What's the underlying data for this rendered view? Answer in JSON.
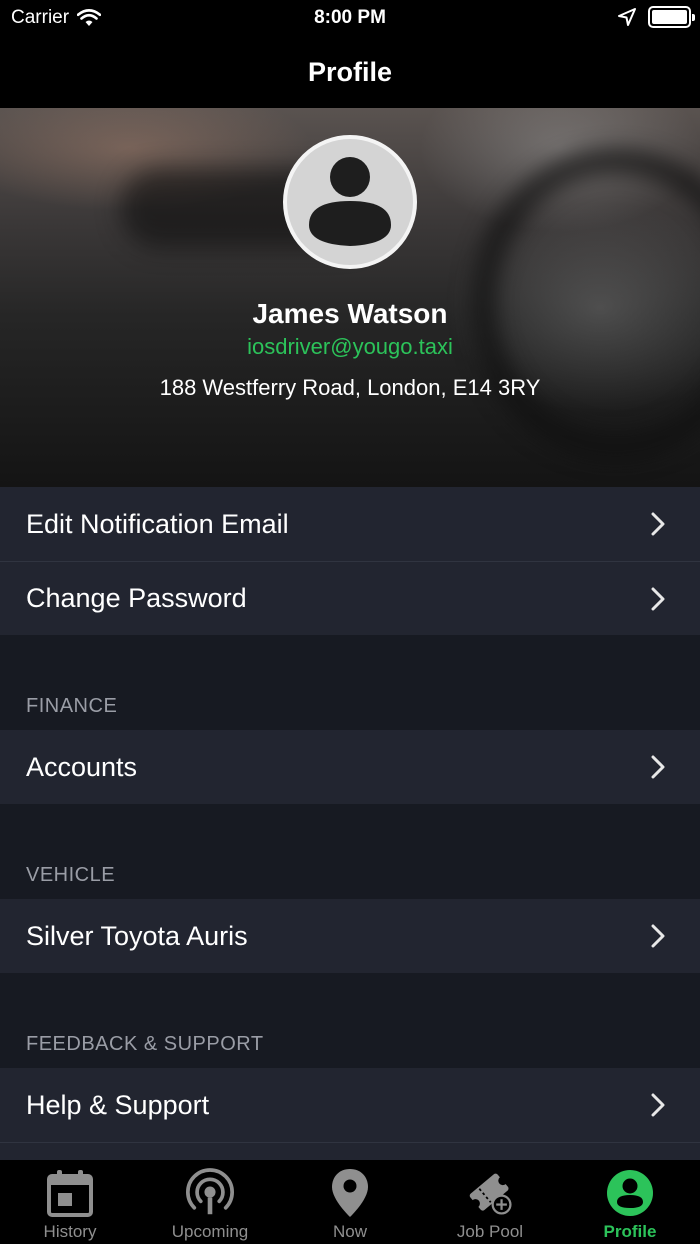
{
  "status_bar": {
    "carrier": "Carrier",
    "time": "8:00 PM"
  },
  "nav": {
    "title": "Profile"
  },
  "profile": {
    "name": "James Watson",
    "email": "iosdriver@yougo.taxi",
    "address": "188 Westferry Road, London, E14 3RY"
  },
  "account_rows": [
    {
      "label": "Edit Notification Email"
    },
    {
      "label": "Change Password"
    }
  ],
  "finance": {
    "header": "FINANCE",
    "rows": [
      {
        "label": "Accounts"
      }
    ]
  },
  "vehicle": {
    "header": "VEHICLE",
    "rows": [
      {
        "label": "Silver Toyota Auris"
      }
    ]
  },
  "support": {
    "header": "FEEDBACK & SUPPORT",
    "rows": [
      {
        "label": "Help & Support"
      }
    ]
  },
  "tabs": [
    {
      "label": "History",
      "icon": "calendar-icon"
    },
    {
      "label": "Upcoming",
      "icon": "broadcast-icon"
    },
    {
      "label": "Now",
      "icon": "location-pin-icon"
    },
    {
      "label": "Job Pool",
      "icon": "ticket-add-icon"
    },
    {
      "label": "Profile",
      "icon": "profile-icon",
      "active": true
    }
  ],
  "colors": {
    "accent": "#2cc35a",
    "row_bg": "#222530",
    "page_bg": "#171a22",
    "bar_bg": "#000000"
  }
}
